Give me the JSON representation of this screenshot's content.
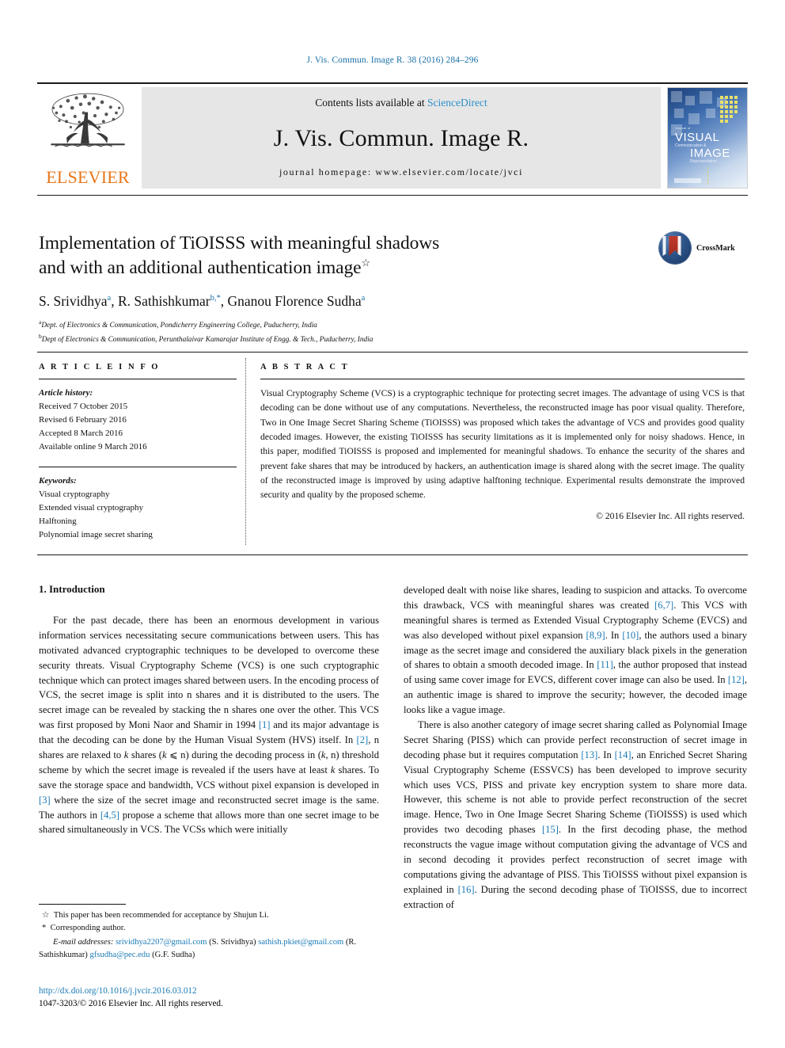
{
  "running_head": "J. Vis. Commun. Image R. 38 (2016) 284–296",
  "masthead": {
    "publisher": "ELSEVIER",
    "contents_prefix": "Contents lists available at ",
    "contents_link": "ScienceDirect",
    "journal_name": "J. Vis. Commun. Image R.",
    "homepage": "journal homepage: www.elsevier.com/locate/jvci",
    "cover": {
      "line1": "Journal of",
      "visual": "VISUAL",
      "sub1": "Communication &",
      "image": "IMAGE",
      "sub2": "Representation"
    }
  },
  "article": {
    "title_line1": "Implementation of TiOISSS with meaningful shadows",
    "title_line2": "and with an additional authentication image",
    "title_footnote_marker": "☆",
    "authors": [
      {
        "name": "S. Srividhya",
        "sup": "a"
      },
      {
        "name": "R. Sathishkumar",
        "sup": "b,*"
      },
      {
        "name": "Gnanou Florence Sudha",
        "sup": "a"
      }
    ],
    "authors_plain": "S. Srividhya a, R. Sathishkumar b,*, Gnanou Florence Sudha a",
    "affiliations": [
      {
        "marker": "a",
        "text": "Dept. of Electronics & Communication, Pondicherry Engineering College, Puducherry, India"
      },
      {
        "marker": "b",
        "text": "Dept of Electronics & Communication, Perunthalaivar Kamarajar Institute of Engg. & Tech., Puducherry, India"
      }
    ],
    "crossmark_label": "CrossMark"
  },
  "info": {
    "heading": "A R T I C L E    I N F O",
    "history_label": "Article history:",
    "history": [
      "Received 7 October 2015",
      "Revised 6 February 2016",
      "Accepted 8 March 2016",
      "Available online 9 March 2016"
    ],
    "keywords_label": "Keywords:",
    "keywords": [
      "Visual cryptography",
      "Extended visual cryptography",
      "Halftoning",
      "Polynomial image secret sharing"
    ]
  },
  "abstract": {
    "heading": "A B S T R A C T",
    "text": "Visual Cryptography Scheme (VCS) is a cryptographic technique for protecting secret images. The advantage of using VCS is that decoding can be done without use of any computations. Nevertheless, the reconstructed image has poor visual quality. Therefore, Two in One Image Secret Sharing Scheme (TiOISSS) was proposed which takes the advantage of VCS and provides good quality decoded images. However, the existing TiOISSS has security limitations as it is implemented only for noisy shadows. Hence, in this paper, modified TiOISSS is proposed and implemented for meaningful shadows. To enhance the security of the shares and prevent fake shares that may be introduced by hackers, an authentication image is shared along with the secret image. The quality of the reconstructed image is improved by using adaptive halftoning technique. Experimental results demonstrate the improved security and quality by the proposed scheme.",
    "copyright": "© 2016 Elsevier Inc. All rights reserved."
  },
  "body": {
    "section_number_title": "1. Introduction",
    "left_paragraph": "For the past decade, there has been an enormous development in various information services necessitating secure communications between users. This has motivated advanced cryptographic techniques to be developed to overcome these security threats. Visual Cryptography Scheme (VCS) is one such cryptographic technique which can protect images shared between users. In the encoding process of VCS, the secret image is split into n shares and it is distributed to the users. The secret image can be revealed by stacking the n shares one over the other. This VCS was first proposed by Moni Naor and Shamir in 1994 [1] and its major advantage is that the decoding can be done by the Human Visual System (HVS) itself. In [2], n shares are relaxed to k shares (k ⩽ n) during the decoding process in (k, n) threshold scheme by which the secret image is revealed if the users have at least k shares. To save the storage space and bandwidth, VCS without pixel expansion is developed in [3] where the size of the secret image and reconstructed secret image is the same. The authors in [4,5] propose a scheme that allows more than one secret image to be shared simultaneously in VCS. The VCSs which were initially",
    "right_paragraph_1": "developed dealt with noise like shares, leading to suspicion and attacks. To overcome this drawback, VCS with meaningful shares was created [6,7]. This VCS with meaningful shares is termed as Extended Visual Cryptography Scheme (EVCS) and was also developed without pixel expansion [8,9]. In [10], the authors used a binary image as the secret image and considered the auxiliary black pixels in the generation of shares to obtain a smooth decoded image. In [11], the author proposed that instead of using same cover image for EVCS, different cover image can also be used. In [12], an authentic image is shared to improve the security; however, the decoded image looks like a vague image.",
    "right_paragraph_2": "There is also another category of image secret sharing called as Polynomial Image Secret Sharing (PISS) which can provide perfect reconstruction of secret image in decoding phase but it requires computation [13]. In [14], an Enriched Secret Sharing Visual Cryptography Scheme (ESSVCS) has been developed to improve security which uses VCS, PISS and private key encryption system to share more data. However, this scheme is not able to provide perfect reconstruction of the secret image. Hence, Two in One Image Secret Sharing Scheme (TiOISSS) is used which provides two decoding phases [15]. In the first decoding phase, the method reconstructs the vague image without computation giving the advantage of VCS and in second decoding it provides perfect reconstruction of secret image with computations giving the advantage of PISS. This TiOISSS without pixel expansion is explained in [16]. During the second decoding phase of TiOISSS, due to incorrect extraction of"
  },
  "footnotes": {
    "star_note": "This paper has been recommended for acceptance by Shujun Li.",
    "corresponding": "Corresponding author.",
    "email_label": "E-mail addresses:",
    "emails": [
      {
        "address": "srividhya2207@gmail.com",
        "owner": "(S. Srividhya)"
      },
      {
        "address": "sathish.pkiet@gmail.com",
        "owner": "(R. Sathishkumar)"
      },
      {
        "address": "gfsudha@pec.edu",
        "owner": "(G.F. Sudha)"
      }
    ],
    "doi": "http://dx.doi.org/10.1016/j.jvcir.2016.03.012",
    "issn_line": "1047-3203/© 2016 Elsevier Inc. All rights reserved."
  },
  "colors": {
    "link": "#1a7ab5",
    "elsevier_orange": "#e8761a",
    "running_head": "#1a6fa8"
  }
}
